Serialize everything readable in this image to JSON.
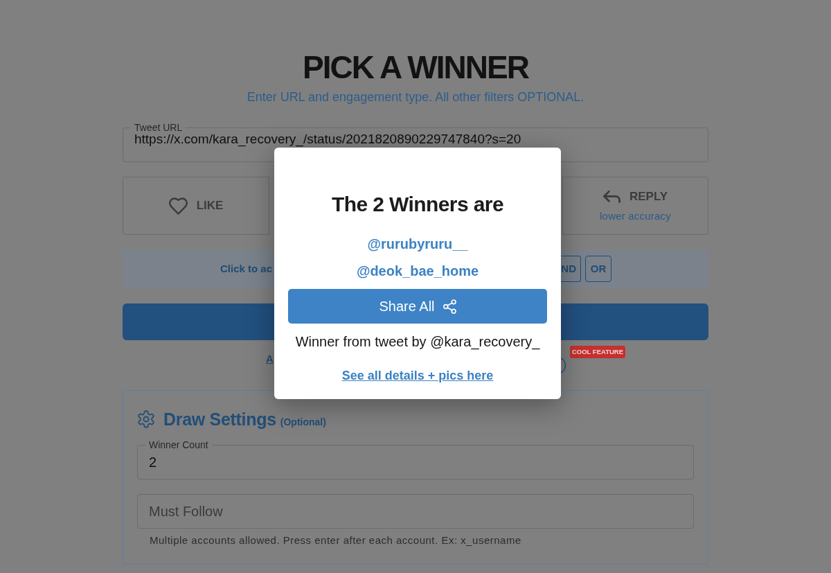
{
  "header": {
    "title": "PICK A WINNER",
    "subtitle": "Enter URL and engagement type. All other filters OPTIONAL."
  },
  "tweet_url": {
    "label": "Tweet URL",
    "value": "https://x.com/kara_recovery_/status/2021820890229747840?s=20"
  },
  "engagement_types": [
    {
      "kind": "like",
      "label": "LIKE",
      "selected": false
    },
    {
      "kind": "reply",
      "label": "REPLY",
      "note": "lower accuracy",
      "selected": false
    }
  ],
  "combine_bar": {
    "hint": "Click to ac",
    "operators": [
      {
        "label": "ND",
        "selected": false
      },
      {
        "label": "OR",
        "selected": false
      }
    ]
  },
  "link_row": {
    "link": "A",
    "badge": "COOL FEATURE"
  },
  "draw_settings": {
    "title": "Draw Settings",
    "note": "(Optional)",
    "winner_count": {
      "label": "Winner Count",
      "value": "2"
    },
    "must_follow": {
      "placeholder": "Must Follow",
      "help": "Multiple accounts allowed. Press enter after each account. Ex: x_username"
    }
  },
  "dialog": {
    "title": "The 2 Winners are",
    "winners": [
      "@rurubyruru__",
      "@deok_bae_home"
    ],
    "share_button": "Share All",
    "source": "Winner from tweet by @kara_recovery_",
    "details_link": "See all details + pics here"
  }
}
